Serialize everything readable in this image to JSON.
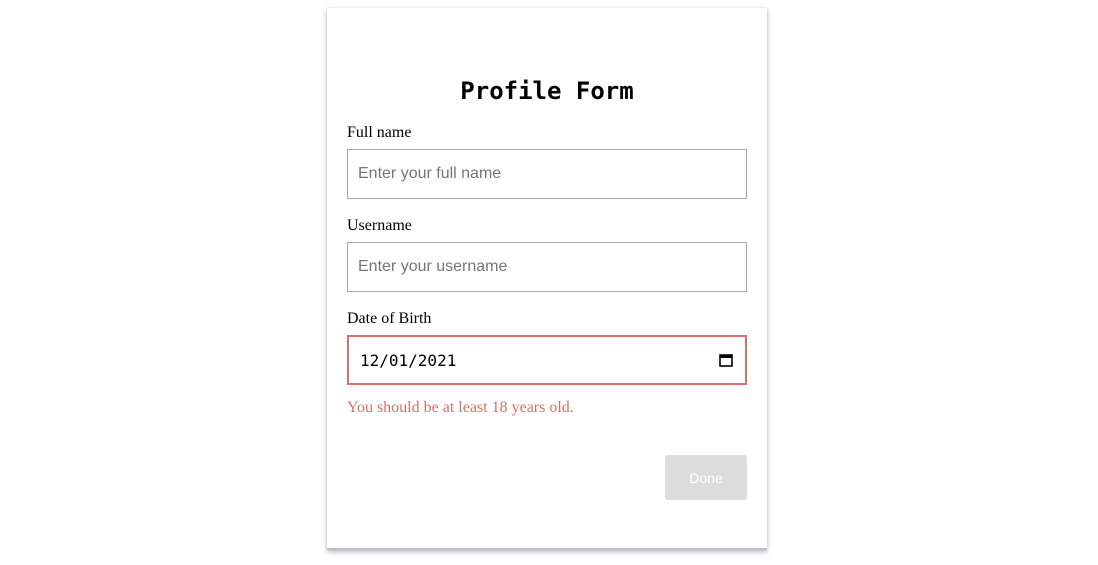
{
  "form": {
    "title": "Profile Form",
    "full_name": {
      "label": "Full name",
      "value": "",
      "placeholder": "Enter your full name"
    },
    "username": {
      "label": "Username",
      "value": "",
      "placeholder": "Enter your username"
    },
    "dob": {
      "label": "Date of Birth",
      "value": "12/01/2021",
      "icon": "calendar-icon"
    },
    "error_message": "You should be at least 18 years old.",
    "done_label": "Done",
    "done_disabled": true
  },
  "colors": {
    "error": "#d9706b",
    "button_disabled_bg": "#dcdcdc",
    "button_text": "#ffffff",
    "input_border": "#a9a9a9"
  }
}
